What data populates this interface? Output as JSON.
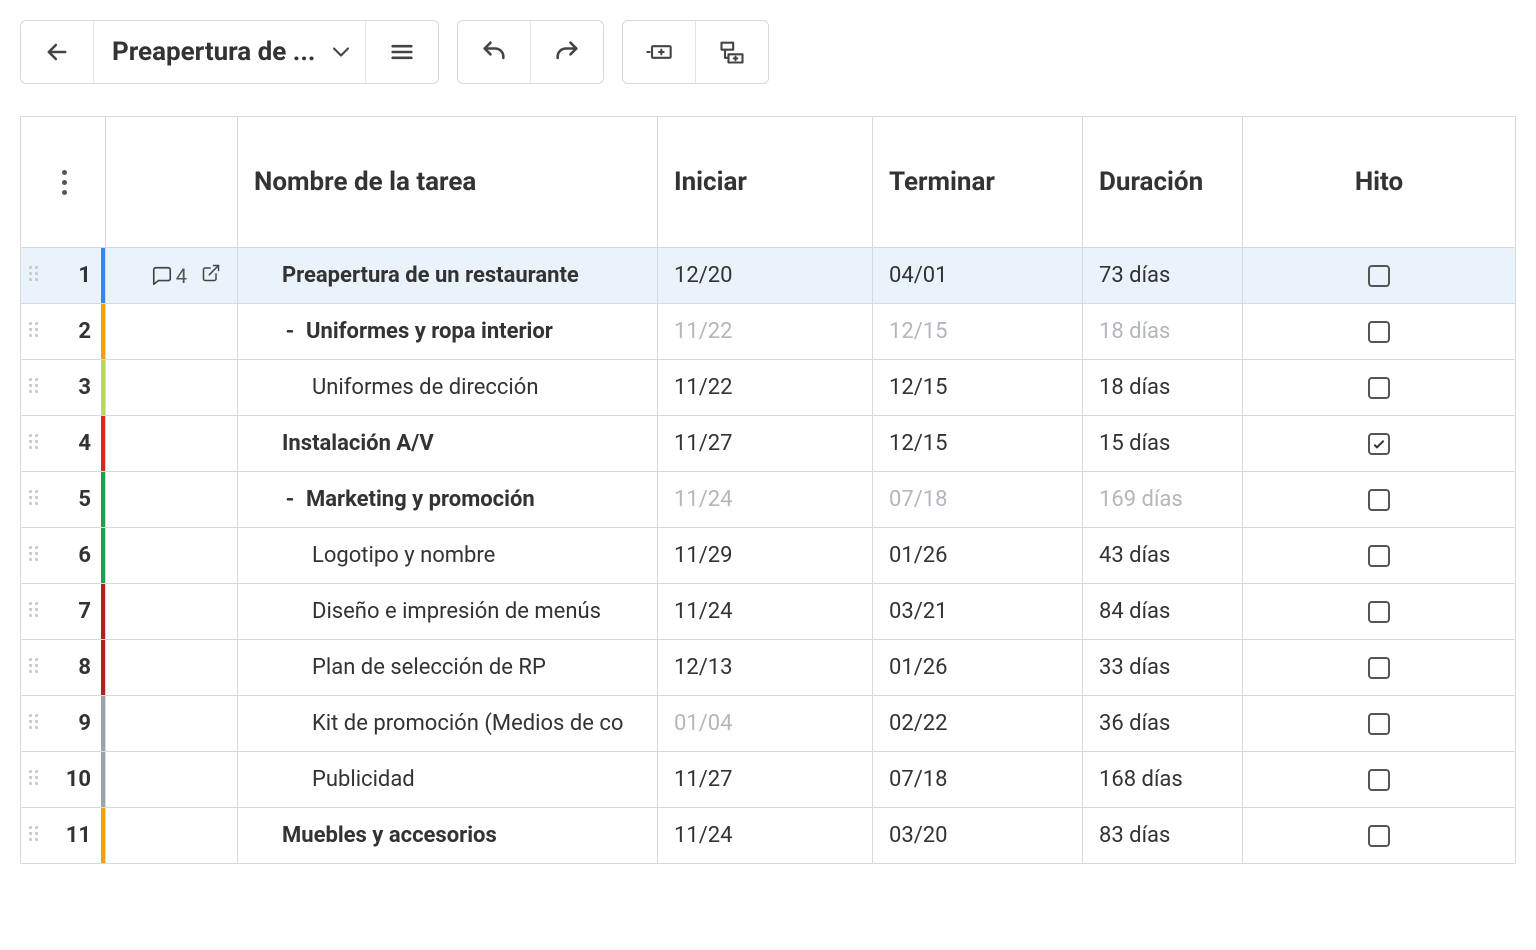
{
  "toolbar": {
    "project_title": "Preapertura de ..."
  },
  "columns": {
    "name": "Nombre de la tarea",
    "start": "Iniciar",
    "end": "Terminar",
    "duration": "Duración",
    "milestone": "Hito"
  },
  "rows": [
    {
      "num": "1",
      "color": "#3b82f6",
      "selected": true,
      "comments": "4",
      "bold": true,
      "indent": 0,
      "collapse": false,
      "name": "Preapertura de un restaurante",
      "start": "12/20",
      "end": "04/01",
      "dur": "73 días",
      "muted": false,
      "startMuted": false,
      "hito": false
    },
    {
      "num": "2",
      "color": "#f59e0b",
      "selected": false,
      "comments": "",
      "bold": true,
      "indent": 1,
      "collapse": true,
      "name": "Uniformes y ropa interior",
      "start": "11/22",
      "end": "12/15",
      "dur": "18 días",
      "muted": true,
      "startMuted": true,
      "hito": false
    },
    {
      "num": "3",
      "color": "#bada55",
      "selected": false,
      "comments": "",
      "bold": false,
      "indent": 2,
      "collapse": false,
      "name": "Uniformes de dirección",
      "start": "11/22",
      "end": "12/15",
      "dur": "18 días",
      "muted": false,
      "startMuted": false,
      "hito": false
    },
    {
      "num": "4",
      "color": "#dc2626",
      "selected": false,
      "comments": "",
      "bold": true,
      "indent": 1,
      "collapse": false,
      "name": "Instalación A/V",
      "start": "11/27",
      "end": "12/15",
      "dur": "15 días",
      "muted": false,
      "startMuted": false,
      "hito": true
    },
    {
      "num": "5",
      "color": "#16a34a",
      "selected": false,
      "comments": "",
      "bold": true,
      "indent": 1,
      "collapse": true,
      "name": "Marketing y promoción",
      "start": "11/24",
      "end": "07/18",
      "dur": "169 días",
      "muted": true,
      "startMuted": true,
      "hito": false
    },
    {
      "num": "6",
      "color": "#16a34a",
      "selected": false,
      "comments": "",
      "bold": false,
      "indent": 2,
      "collapse": false,
      "name": "Logotipo y nombre",
      "start": "11/29",
      "end": "01/26",
      "dur": "43 días",
      "muted": false,
      "startMuted": false,
      "hito": false
    },
    {
      "num": "7",
      "color": "#b91c1c",
      "selected": false,
      "comments": "",
      "bold": false,
      "indent": 2,
      "collapse": false,
      "name": "Diseño e impresión de menús",
      "start": "11/24",
      "end": "03/21",
      "dur": "84 días",
      "muted": false,
      "startMuted": false,
      "hito": false
    },
    {
      "num": "8",
      "color": "#b91c1c",
      "selected": false,
      "comments": "",
      "bold": false,
      "indent": 2,
      "collapse": false,
      "name": "Plan de selección de RP",
      "start": "12/13",
      "end": "01/26",
      "dur": "33 días",
      "muted": false,
      "startMuted": false,
      "hito": false
    },
    {
      "num": "9",
      "color": "#9ca3af",
      "selected": false,
      "comments": "",
      "bold": false,
      "indent": 2,
      "collapse": false,
      "name": "Kit de promoción (Medios de co",
      "start": "01/04",
      "end": "02/22",
      "dur": "36 días",
      "muted": false,
      "startMuted": true,
      "hito": false
    },
    {
      "num": "10",
      "color": "#9ca3af",
      "selected": false,
      "comments": "",
      "bold": false,
      "indent": 2,
      "collapse": false,
      "name": "Publicidad",
      "start": "11/27",
      "end": "07/18",
      "dur": "168 días",
      "muted": false,
      "startMuted": false,
      "hito": false
    },
    {
      "num": "11",
      "color": "#f59e0b",
      "selected": false,
      "comments": "",
      "bold": true,
      "indent": 1,
      "collapse": false,
      "name": "Muebles y accesorios",
      "start": "11/24",
      "end": "03/20",
      "dur": "83 días",
      "muted": false,
      "startMuted": false,
      "hito": false
    }
  ]
}
